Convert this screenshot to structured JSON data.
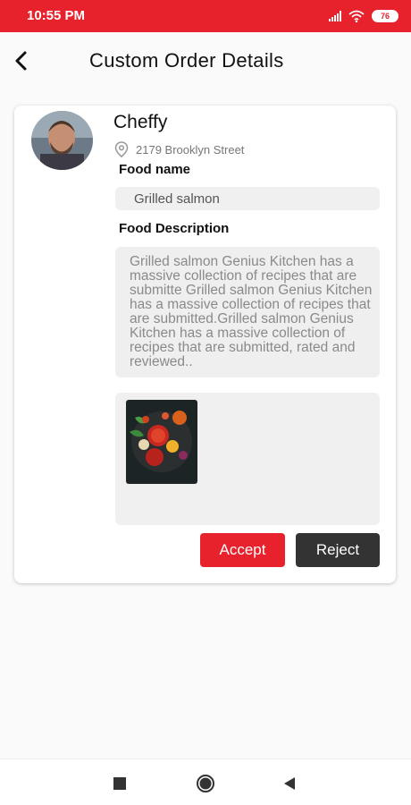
{
  "status_bar": {
    "time": "10:55 PM",
    "battery": "76",
    "icons": [
      "signal-icon",
      "wifi-icon",
      "battery-icon"
    ],
    "background_color": "#e8222c"
  },
  "header": {
    "title": "Custom Order Details",
    "back_icon": "back-arrow-icon"
  },
  "order": {
    "chef_name": "Cheffy",
    "location": "2179  Brooklyn Street",
    "food_name_label": "Food name",
    "food_name_value": "Grilled salmon",
    "food_description_label": "Food Description",
    "food_description": "Grilled salmon  Genius Kitchen has a massive collection of recipes that are submitte Grilled salmon  Genius Kitchen has a massive collection of recipes that are submitted.Grilled salmon  Genius Kitchen has a massive collection of recipes that are submitted, rated and reviewed..",
    "accept_label": "Accept",
    "reject_label": "Reject"
  },
  "colors": {
    "accent": "#e8222c",
    "reject": "#333333"
  },
  "nav_bar": {
    "icons": [
      "recent-apps-icon",
      "home-icon",
      "back-triangle-icon"
    ]
  }
}
